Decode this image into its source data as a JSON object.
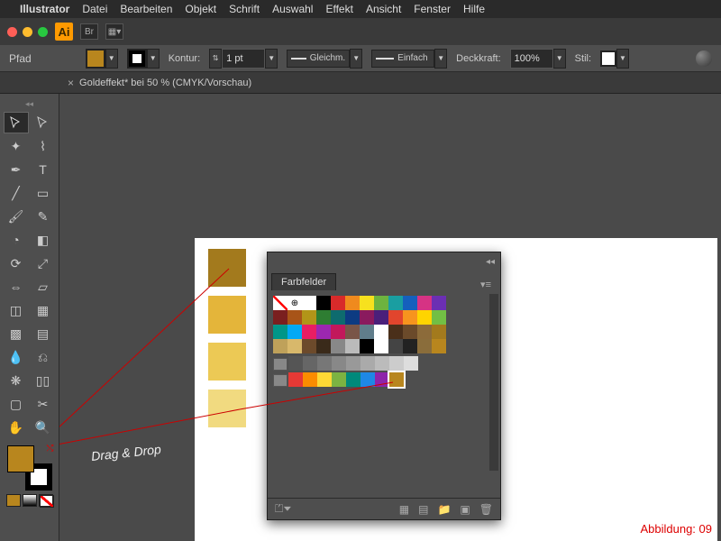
{
  "menubar": {
    "app": "Illustrator",
    "items": [
      "Datei",
      "Bearbeiten",
      "Objekt",
      "Schrift",
      "Auswahl",
      "Effekt",
      "Ansicht",
      "Fenster",
      "Hilfe"
    ]
  },
  "titlebar": {
    "logo": "Ai",
    "br": "Br"
  },
  "options": {
    "path_label": "Pfad",
    "fill_color": "#b8861e",
    "stroke_label": "Kontur:",
    "stroke_pt": "1 pt",
    "align": "Gleichm.",
    "cap": "Einfach",
    "opacity_label": "Deckkraft:",
    "opacity": "100%",
    "style_label": "Stil:"
  },
  "tab": {
    "title": "Goldeffekt* bei 50 % (CMYK/Vorschau)",
    "close": "×"
  },
  "gold_colors": [
    "#a37a1d",
    "#e4b53a",
    "#ecc955",
    "#f1da80"
  ],
  "panel": {
    "title": "Farbfelder",
    "swatches_rows": [
      [
        "none",
        "reg",
        "#ffffff",
        "#000000",
        "#d82a2a",
        "#ef8a1e",
        "#f7e11e",
        "#6db33f",
        "#1a9ea1",
        "#1560bd",
        "#d63384",
        "#6b2fb3"
      ],
      [
        "#7a1f1f",
        "#a85418",
        "#b29518",
        "#2e7d32",
        "#0e6b6e",
        "#0d3b82",
        "#8a1a5e",
        "#4a1f7a",
        "#e1452d",
        "#f7941e",
        "#ffd400",
        "#72bf44"
      ],
      [
        "#009688",
        "#03a9f4",
        "#e91e63",
        "#9c27b0",
        "#c2185b",
        "#795548",
        "#607d8b",
        "#ffffff",
        "#4a2f1a",
        "#6b4a2a",
        "#8c6b3a",
        "#a37a1d"
      ],
      [
        "#bfa15a",
        "#d8b86b",
        "#6c4a2b",
        "#3a2a1a",
        "#888888",
        "#bbbbbb",
        "#000000",
        "#ffffff",
        "#444444",
        "#222222",
        "#8a6d3b",
        "#b8861e"
      ]
    ],
    "gray_row": [
      "#555555",
      "#666666",
      "#777777",
      "#888888",
      "#999999",
      "#aaaaaa",
      "#bbbbbb",
      "#cccccc",
      "#dddddd"
    ],
    "color_row": [
      "#e53935",
      "#fb8c00",
      "#fdd835",
      "#7cb342",
      "#00897b",
      "#1e88e5",
      "#8e24aa",
      "#b8861e"
    ]
  },
  "annotation": {
    "dnd": "Drag & Drop",
    "caption": "Abbildung: 09"
  }
}
